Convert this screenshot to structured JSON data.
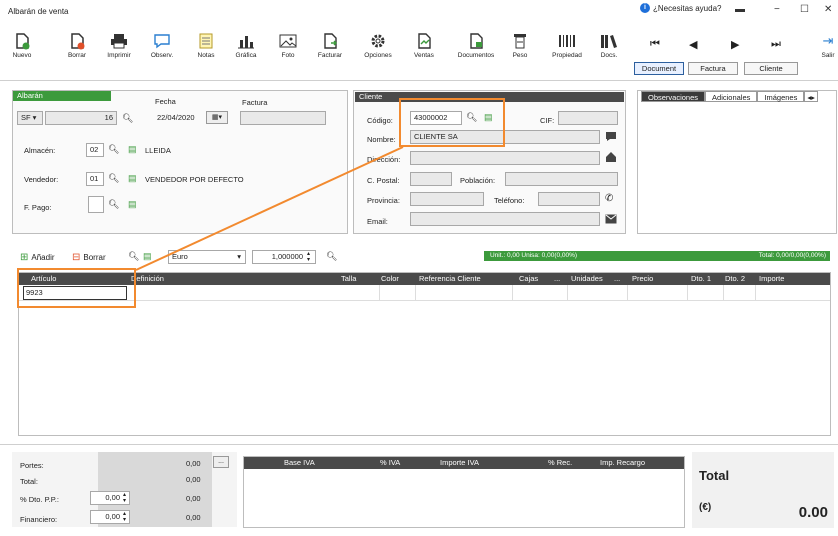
{
  "window": {
    "title": "Albarán de venta",
    "help": "¿Necesitas ayuda?"
  },
  "toolbar": [
    {
      "label": "Nuevo",
      "icon": "new-doc-icon"
    },
    {
      "label": "Borrar",
      "icon": "delete-doc-icon"
    },
    {
      "label": "Imprimir",
      "icon": "printer-icon"
    },
    {
      "label": "Observ.",
      "icon": "comment-icon"
    },
    {
      "label": "Notas",
      "icon": "notes-icon"
    },
    {
      "label": "Gráfica",
      "icon": "chart-icon"
    },
    {
      "label": "Foto",
      "icon": "photo-icon"
    },
    {
      "label": "Facturar",
      "icon": "invoice-icon"
    },
    {
      "label": "Opciones",
      "icon": "gear-icon"
    },
    {
      "label": "Ventas",
      "icon": "sales-icon"
    },
    {
      "label": "Documentos",
      "icon": "documents-icon"
    },
    {
      "label": "Peso",
      "icon": "scale-icon"
    },
    {
      "label": "Propiedad",
      "icon": "barcode-icon"
    },
    {
      "label": "Docs.",
      "icon": "library-icon"
    }
  ],
  "nav_buttons": [
    "Document",
    "Factura",
    "Cliente"
  ],
  "toolbar_right": {
    "exit_label": "Salir"
  },
  "albaran": {
    "header": "Albarán",
    "serie": "SF",
    "numero": "16",
    "fecha_label": "Fecha",
    "fecha": "22/04/2020",
    "factura_label": "Factura",
    "almacen_label": "Almacén:",
    "almacen_code": "02",
    "almacen_name": "LLEIDA",
    "vendedor_label": "Vendedor:",
    "vendedor_code": "01",
    "vendedor_name": "VENDEDOR POR DEFECTO",
    "fpago_label": "F. Pago:"
  },
  "cliente": {
    "header": "Cliente",
    "codigo_label": "Código:",
    "codigo": "43000002",
    "cif_label": "CIF:",
    "nombre_label": "Nombre:",
    "nombre": "CLIENTE SA",
    "direccion_label": "Dirección:",
    "cpostal_label": "C. Postal:",
    "poblacion_label": "Población:",
    "provincia_label": "Provincia:",
    "telefono_label": "Teléfono:",
    "email_label": "Email:"
  },
  "tabs": [
    "Observaciones",
    "Adicionales",
    "Imágenes"
  ],
  "lines": {
    "add_label": "Añadir",
    "delete_label": "Borrar",
    "currency": "Euro",
    "rate": "1,000000",
    "unit_summary": "Unit.: 0,00   Unisa: 0,00(0,00%)",
    "total_summary": "Total: 0,00/0,00(0,00%)",
    "columns": [
      "Artículo",
      "Definición",
      "Talla",
      "Color",
      "Referencia Cliente",
      "Cajas",
      "...",
      "Unidades",
      "...",
      "Precio",
      "Dto. 1",
      "Dto. 2",
      "Importe"
    ],
    "first_article": "9923"
  },
  "footer": {
    "portes_label": "Portes:",
    "portes": "0,00",
    "total_label": "Total:",
    "total": "0,00",
    "dto_label": "% Dto. P.P.:",
    "dto_pct": "0,00",
    "dto_value": "0,00",
    "fin_label": "Financiero:",
    "fin_pct": "0,00",
    "fin_value": "0,00",
    "iva_columns": [
      "Base IVA",
      "% IVA",
      "Importe IVA",
      "% Rec.",
      "Imp. Recargo"
    ],
    "grand_total_label": "Total",
    "currency_symbol": "(€)",
    "grand_total": "0.00"
  },
  "colors": {
    "green": "#3c9a3c",
    "dark": "#4a4a4a",
    "highlight": "#f28a2f"
  }
}
